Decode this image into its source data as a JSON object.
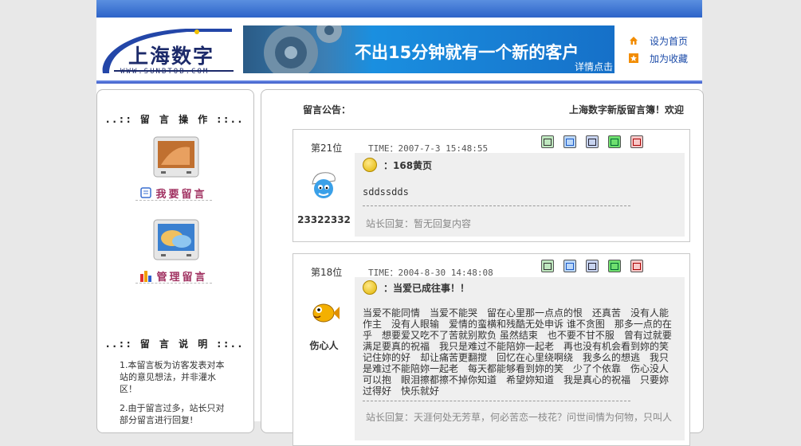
{
  "header": {
    "logo_text": "上海数字",
    "logo_url": "WWW.SUNBTOB.COM",
    "banner_text": "不出15分钟就有一个新的客户",
    "banner_sub": "详情点击",
    "link_home": "设为首页",
    "link_fav": "加为收藏"
  },
  "left": {
    "ops_title": "..:: 留 言 操 作 ::..",
    "write_label": "我要留言",
    "manage_label": "管理留言",
    "notes_title": "..:: 留 言 说 明 ::..",
    "note1": "1.本留言板为访客发表对本站的意见想法，并非灌水区！",
    "note2": "2.由于留言过多，站长只对部分留言进行回复!"
  },
  "notice": {
    "label": "留言公告：",
    "text": "上海数字新版留言簿！欢迎"
  },
  "entries": [
    {
      "floor": "第21位",
      "time": "TIME：2007-7-3 15:48:55",
      "author": "23322332",
      "subject": "：168黄页",
      "body": "sddssdds",
      "reply": "站长回复：暂无回复内容"
    },
    {
      "floor": "第18位",
      "time": "TIME：2004-8-30 14:48:08",
      "author": "伤心人",
      "subject": "：当爱已成往事！！",
      "body": "当爱不能同情　当爱不能哭　留在心里那一点点的恨　还真苦　没有人能作主　没有人眼输　爱情的蛮横和残酷无处申诉 谁不贪图　那多一点的在乎　想要爱又吃不了苦就别欺负 虽然结束　也不要不甘不服　曾有过就要满足要真的祝福　我只是难过不能陪妳一起老　再也没有机会看到妳的笑 记住妳的好　却让痛苦更翻搅　回忆在心里绕啊绕　我多么的想逃　我只是难过不能陪妳一起老　每天都能够看到妳的笑　少了个依靠　伤心没人可以抱　眼泪擦都擦不掉你知道　希望妳知道　我是真心的祝福　只要妳过得好　快乐就好",
      "reply": "站长回复：天涯何处无芳草，何必苦恋一枝花？问世间情为何物，只叫人"
    }
  ],
  "colors": {
    "topbar": "#2d63c8",
    "link": "#1a4aa8",
    "menu": "#a03060"
  }
}
